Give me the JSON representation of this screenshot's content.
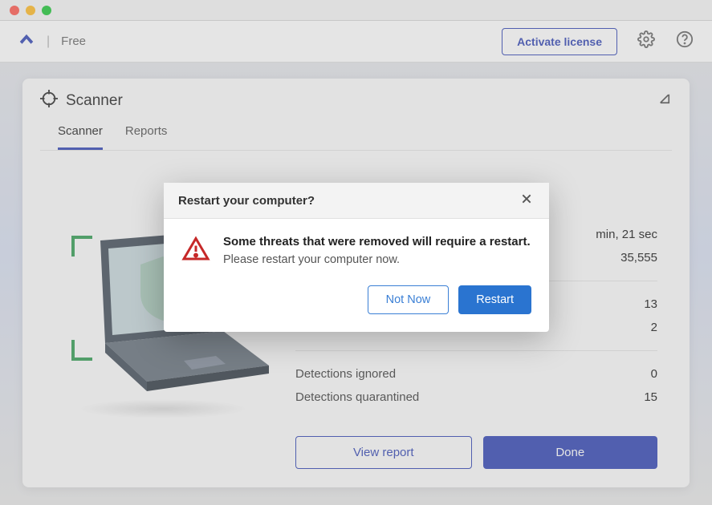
{
  "header": {
    "tier_label": "Free",
    "activate_label": "Activate license"
  },
  "card": {
    "title": "Scanner",
    "tabs": {
      "scanner": "Scanner",
      "reports": "Reports"
    }
  },
  "results": {
    "time_value": "min, 21 sec",
    "items_value": "35,555",
    "detections_value": "13",
    "pups_value": "2",
    "ignored_label": "Detections ignored",
    "ignored_value": "0",
    "quarantined_label": "Detections quarantined",
    "quarantined_value": "15",
    "view_report_label": "View report",
    "done_label": "Done"
  },
  "modal": {
    "title": "Restart your computer?",
    "heading": "Some threats that were removed will require a restart.",
    "subtext": "Please restart your computer now.",
    "not_now_label": "Not Now",
    "restart_label": "Restart"
  }
}
